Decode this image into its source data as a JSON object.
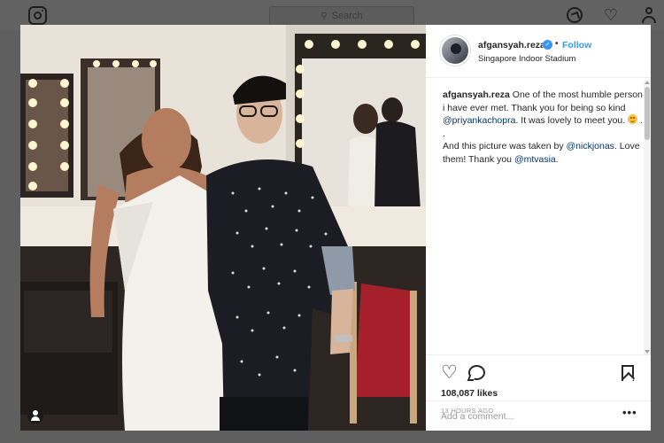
{
  "nav": {
    "search_placeholder": "Search",
    "icons": [
      "instagram-logo-icon",
      "search-icon",
      "compass-icon",
      "heart-icon",
      "person-icon"
    ]
  },
  "post": {
    "username": "afgansyah.reza",
    "follow_label": "Follow",
    "location": "Singapore Indoor Stadium",
    "caption": {
      "author": "afgansyah.reza",
      "line1": " One of the most humble person i have ever met. Thank you for being so kind ",
      "mention1": "@priyankachopra",
      "line2": ". It was lovely to meet you. ",
      "line3": " .",
      "dot": ".",
      "line4": "And this picture was taken by ",
      "mention2": "@nickjonas",
      "line5": ". Love them! Thank you ",
      "mention3": "@mtvasia",
      "line6": "."
    },
    "likes": "108,087 likes",
    "timestamp": "13 HOURS AGO",
    "comment_placeholder": "Add a comment...",
    "more": "•••"
  },
  "colors": {
    "accent": "#3897f0",
    "mention": "#003569",
    "overlay": "#5f5f5f"
  }
}
